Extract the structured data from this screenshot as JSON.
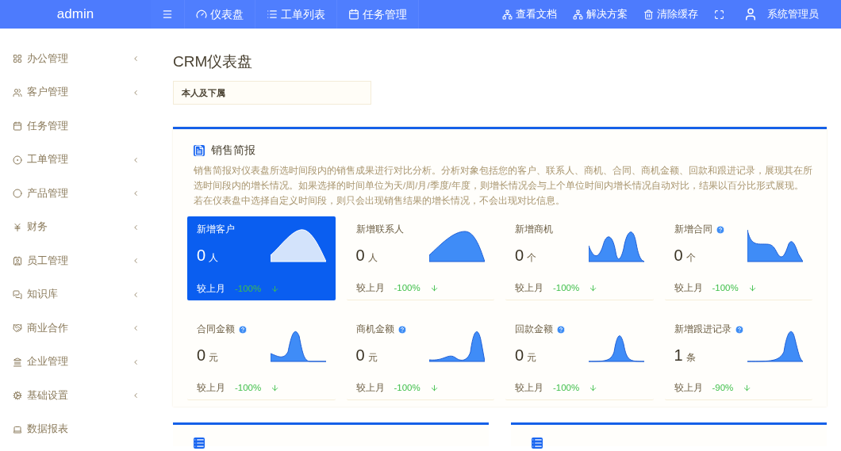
{
  "header": {
    "brand": "admin",
    "nav": [
      {
        "label": "仪表盘"
      },
      {
        "label": "工单列表"
      },
      {
        "label": "任务管理"
      }
    ],
    "actions": [
      {
        "label": "查看文档"
      },
      {
        "label": "解决方案"
      },
      {
        "label": "清除缓存"
      }
    ],
    "user": "系统管理员"
  },
  "sidebar": {
    "items": [
      {
        "label": "办公管理",
        "expandable": true
      },
      {
        "label": "客户管理",
        "expandable": true
      },
      {
        "label": "任务管理",
        "expandable": false
      },
      {
        "label": "工单管理",
        "expandable": true
      },
      {
        "label": "产品管理",
        "expandable": true
      },
      {
        "label": "财务",
        "expandable": true
      },
      {
        "label": "员工管理",
        "expandable": true
      },
      {
        "label": "知识库",
        "expandable": true
      },
      {
        "label": "商业合作",
        "expandable": true
      },
      {
        "label": "企业管理",
        "expandable": true
      },
      {
        "label": "基础设置",
        "expandable": true
      },
      {
        "label": "数据报表",
        "expandable": false
      }
    ]
  },
  "page_title": "CRM仪表盘",
  "tabs": [
    {
      "label": "本人及下属",
      "selected": true
    }
  ],
  "sales_panel": {
    "title": "销售简报",
    "description": "销售简报对仪表盘所选时间段内的销售成果进行对比分析。分析对象包括您的客户、联系人、商机、合同、商机金额、回款和跟进记录，展现其在所选时间段内的增长情况。如果选择的时间单位为天/周/月/季度/年度，则增长情况会与上个单位时间内增长情况自动对比，结果以百分比形式展现。若在仪表盘中选择自定义时间段，则只会出现销售结果的增长情况，不会出现对比信息。",
    "cards": [
      {
        "title": "新增客户",
        "help": false,
        "value": "0",
        "unit": "人",
        "compare_label": "较上月",
        "change": "-100%",
        "selected": true
      },
      {
        "title": "新增联系人",
        "help": false,
        "value": "0",
        "unit": "人",
        "compare_label": "较上月",
        "change": "-100%",
        "selected": false
      },
      {
        "title": "新增商机",
        "help": false,
        "value": "0",
        "unit": "个",
        "compare_label": "较上月",
        "change": "-100%",
        "selected": false
      },
      {
        "title": "新增合同",
        "help": true,
        "value": "0",
        "unit": "个",
        "compare_label": "较上月",
        "change": "-100%",
        "selected": false
      },
      {
        "title": "合同金额",
        "help": true,
        "value": "0",
        "unit": "元",
        "compare_label": "较上月",
        "change": "-100%",
        "selected": false
      },
      {
        "title": "商机金额",
        "help": true,
        "value": "0",
        "unit": "元",
        "compare_label": "较上月",
        "change": "-100%",
        "selected": false
      },
      {
        "title": "回款金额",
        "help": true,
        "value": "0",
        "unit": "元",
        "compare_label": "较上月",
        "change": "-100%",
        "selected": false
      },
      {
        "title": "新增跟进记录",
        "help": true,
        "value": "1",
        "unit": "条",
        "compare_label": "较上月",
        "change": "-90%",
        "selected": false
      }
    ]
  }
}
